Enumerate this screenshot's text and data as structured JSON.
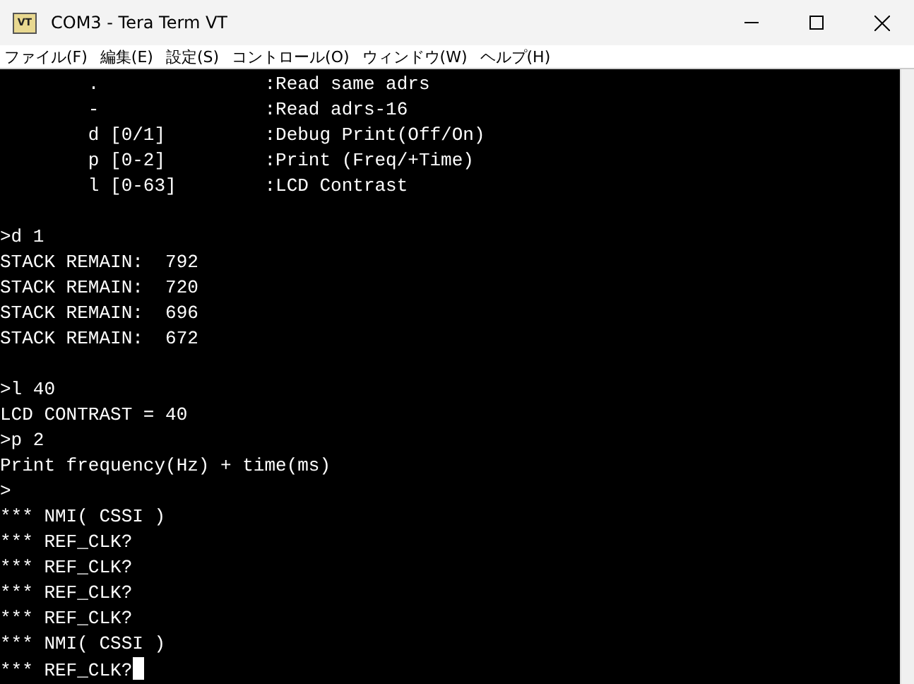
{
  "window": {
    "title": "COM3 - Tera Term VT",
    "app_icon": "VT"
  },
  "menu": [
    "ファイル(F)",
    "編集(E)",
    "設定(S)",
    "コントロール(O)",
    "ウィンドウ(W)",
    "ヘルプ(H)"
  ],
  "terminal": {
    "blocks": [
      [
        "        .               :Read same adrs",
        "        -               :Read adrs-16",
        "        d [0/1]         :Debug Print(Off/On)",
        "        p [0-2]         :Print (Freq/+Time)",
        "        l [0-63]        :LCD Contrast"
      ],
      [
        ">d 1",
        "STACK REMAIN:  792",
        "STACK REMAIN:  720",
        "STACK REMAIN:  696",
        "STACK REMAIN:  672"
      ],
      [
        ">l 40",
        "LCD CONTRAST = 40",
        ">p 2",
        "Print frequency(Hz) + time(ms)",
        ">",
        "*** NMI( CSSI )",
        "*** REF_CLK?",
        "*** REF_CLK?",
        "*** REF_CLK?",
        "*** REF_CLK?",
        "*** NMI( CSSI )",
        "*** REF_CLK?"
      ]
    ],
    "cursor": true
  }
}
